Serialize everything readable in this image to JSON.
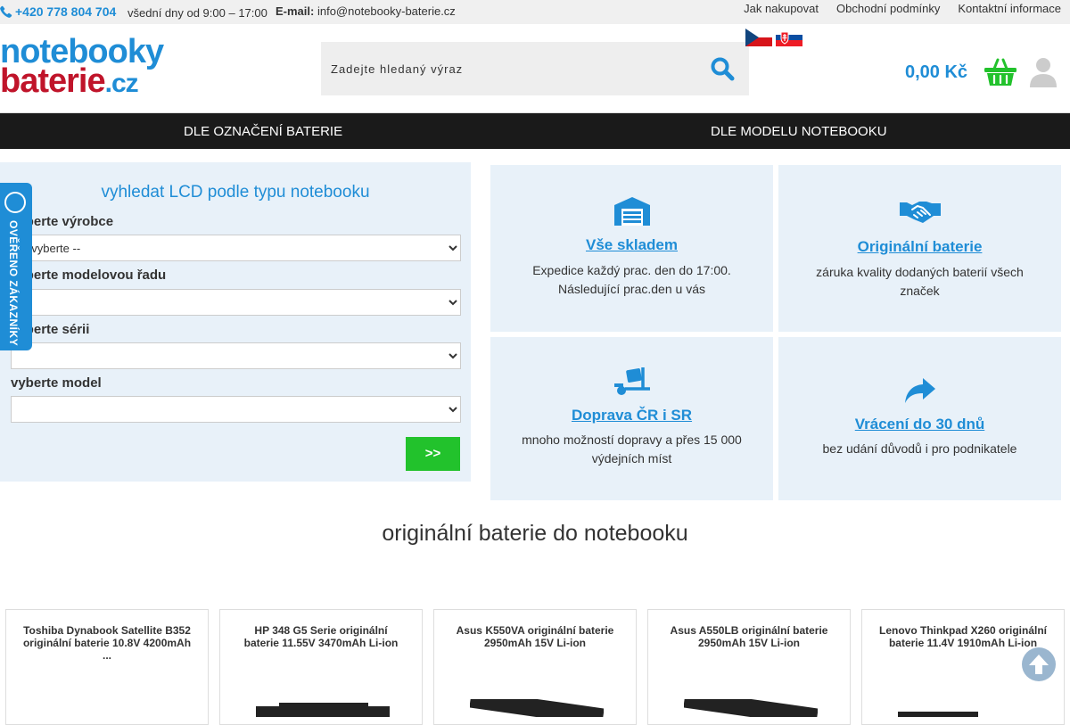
{
  "topbar": {
    "phone": "+420 778 804 704",
    "hours": "všední dny od 9:00 – 17:00",
    "email_label": "E-mail:",
    "email": "info@notebooky-baterie.cz",
    "links": [
      "Jak nakupovat",
      "Obchodní podmínky",
      "Kontaktní informace"
    ]
  },
  "header": {
    "logo_line1": "notebooky",
    "logo_line2": "baterie",
    "logo_suffix": ".cz",
    "search_placeholder": "Zadejte hledaný výraz",
    "cart_total": "0,00 Kč"
  },
  "nav": {
    "item1": "DLE OZNAČENÍ BATERIE",
    "item2": "DLE MODELU NOTEBOOKU"
  },
  "finder": {
    "title": "vyhledat LCD podle typu notebooku",
    "label_manufacturer": "vyberte výrobce",
    "manufacturer_selected": "-- vyberte --",
    "label_series_line": "vyberte modelovou řadu",
    "label_series": "vyberte sérii",
    "label_model": "vyberte model",
    "submit": ">>"
  },
  "badge": {
    "text": "OVĚŘENO ZÁKAZNÍKY"
  },
  "features": [
    {
      "title": "Vše skladem",
      "desc": "Expedice každý prac. den do 17:00. Následující prac.den u vás"
    },
    {
      "title": "Originální baterie",
      "desc": "záruka kvality dodaných baterií všech značek"
    },
    {
      "title": "Doprava ČR i SR",
      "desc": "mnoho možností dopravy a přes 15 000 výdejních míst"
    },
    {
      "title": "Vrácení do 30 dnů",
      "desc": "bez udání důvodů i pro podnikatele"
    }
  ],
  "products_heading": "originální baterie do notebooku",
  "products": [
    {
      "name": "Toshiba Dynabook Satellite B352 originální baterie 10.8V 4200mAh ..."
    },
    {
      "name": "HP 348 G5 Serie originální baterie 11.55V 3470mAh Li-ion"
    },
    {
      "name": "Asus K550VA originální baterie 2950mAh 15V Li-ion"
    },
    {
      "name": "Asus A550LB originální baterie 2950mAh 15V Li-ion"
    },
    {
      "name": "Lenovo Thinkpad X260 originální baterie 11.4V 1910mAh Li-ion"
    }
  ],
  "colors": {
    "brand_blue": "#1f8dd6",
    "brand_red": "#c0142a",
    "nav_bg": "#1a1a1a",
    "panel_bg": "#e8f1f9",
    "go_green": "#22c22c"
  }
}
